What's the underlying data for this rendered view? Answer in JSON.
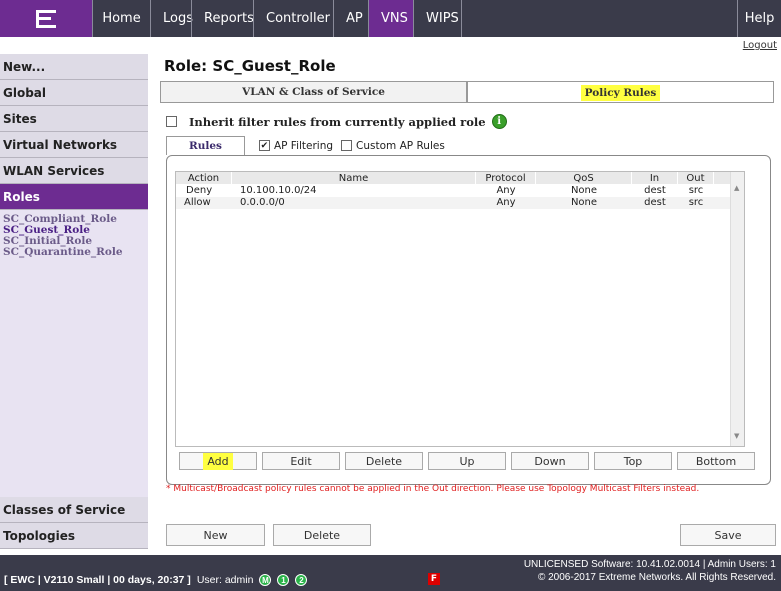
{
  "topbar": {
    "logo_text": "E",
    "nav": [
      "Home",
      "Logs",
      "Reports",
      "Controller",
      "AP",
      "VNS",
      "WIPS"
    ],
    "active": "VNS",
    "help": "Help",
    "logout": "Logout"
  },
  "sidebar": {
    "items": [
      "New...",
      "Global",
      "Sites",
      "Virtual Networks",
      "WLAN Services",
      "Roles"
    ],
    "active": "Roles",
    "roles": [
      "SC_Compliant_Role",
      "SC_Guest_Role",
      "SC_Initial_Role",
      "SC_Quarantine_Role"
    ],
    "active_role": "SC_Guest_Role",
    "bottom_items": [
      "Classes of Service",
      "Topologies"
    ]
  },
  "main": {
    "title": "Role: SC_Guest_Role",
    "tabs": [
      "VLAN & Class of Service",
      "Policy Rules"
    ],
    "active_tab": "Policy Rules",
    "inherit_label": "Inherit filter rules from currently applied role",
    "subtab_rules": "Rules",
    "ap_filtering": "AP Filtering",
    "custom_ap_rules": "Custom AP Rules",
    "columns": [
      "Action",
      "Name",
      "Protocol",
      "QoS",
      "In",
      "Out"
    ],
    "rows": [
      [
        "Deny",
        "10.100.10.0/24",
        "Any",
        "None",
        "dest",
        "src"
      ],
      [
        "Allow",
        "0.0.0.0/0",
        "Any",
        "None",
        "dest",
        "src"
      ]
    ],
    "buttons": [
      "Add",
      "Edit",
      "Delete",
      "Up",
      "Down",
      "Top",
      "Bottom"
    ],
    "note": "* Multicast/Broadcast policy rules cannot be applied in the Out direction. Please use Topology Multicast Filters instead.",
    "new": "New",
    "delete": "Delete",
    "save": "Save"
  },
  "footer": {
    "status": "[ EWC | V2110 Small | 00 days, 20:37 ]",
    "user": "User: admin",
    "badges": [
      "M",
      "1",
      "2"
    ],
    "flag": "F",
    "license": "UNLICENSED Software: 10.41.02.0014 | Admin Users: 1",
    "copyright": "© 2006-2017  Extreme Networks. All Rights Reserved."
  },
  "colors": {
    "brand": "#6d2c91",
    "highlight": "#ffff40",
    "bar": "#3a3b4a",
    "alert": "#e02020"
  }
}
